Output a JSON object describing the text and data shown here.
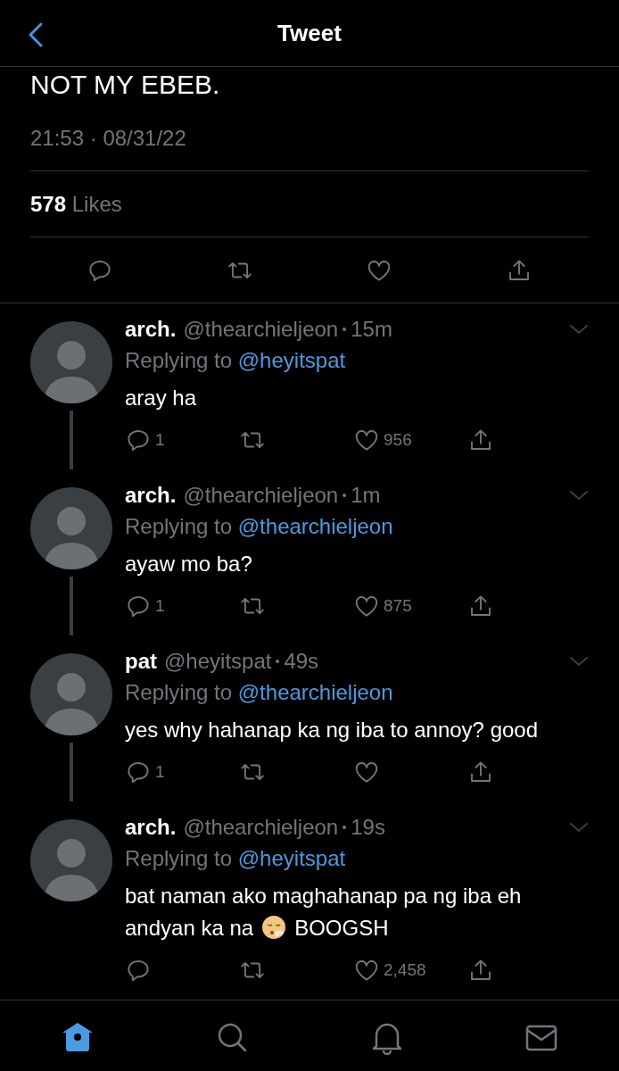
{
  "header": {
    "title": "Tweet"
  },
  "main_tweet": {
    "text": "NOT MY EBEB.",
    "timestamp": "21:53 · 08/31/22",
    "likes_count": "578",
    "likes_label": "Likes"
  },
  "replies": [
    {
      "name": "arch.",
      "handle": "@thearchieljeon",
      "time": "15m",
      "replying_label": "Replying to",
      "replying_to": "@heyitspat",
      "body": [
        {
          "kind": "text",
          "text": "aray ha"
        }
      ],
      "reply_count": "1",
      "like_count": "956",
      "thread_line": true
    },
    {
      "name": "arch.",
      "handle": "@thearchieljeon",
      "time": "1m",
      "replying_label": "Replying to",
      "replying_to": "@thearchieljeon",
      "body": [
        {
          "kind": "text",
          "text": "ayaw mo ba?"
        }
      ],
      "reply_count": "1",
      "like_count": "875",
      "thread_line": true
    },
    {
      "name": "pat",
      "handle": "@heyitspat",
      "time": "49s",
      "replying_label": "Replying to",
      "replying_to": "@thearchieljeon",
      "body": [
        {
          "kind": "text",
          "text": "yes why hahanap ka ng iba to annoy? good"
        }
      ],
      "reply_count": "1",
      "thread_line": true
    },
    {
      "name": "arch.",
      "handle": "@thearchieljeon",
      "time": "19s",
      "replying_label": "Replying to",
      "replying_to": "@heyitspat",
      "body": [
        {
          "kind": "text",
          "text": "bat naman ako maghahanap pa ng iba eh andyan ka na"
        },
        {
          "kind": "emoji"
        },
        {
          "kind": "text",
          "text": "BOOGSH"
        }
      ],
      "like_count": "2,458",
      "thread_line": false
    }
  ],
  "tab_bar": [
    {
      "kind": "home",
      "selected": true
    },
    {
      "kind": "search",
      "selected": false
    },
    {
      "kind": "notifications",
      "selected": false
    },
    {
      "kind": "messages",
      "selected": false
    }
  ]
}
